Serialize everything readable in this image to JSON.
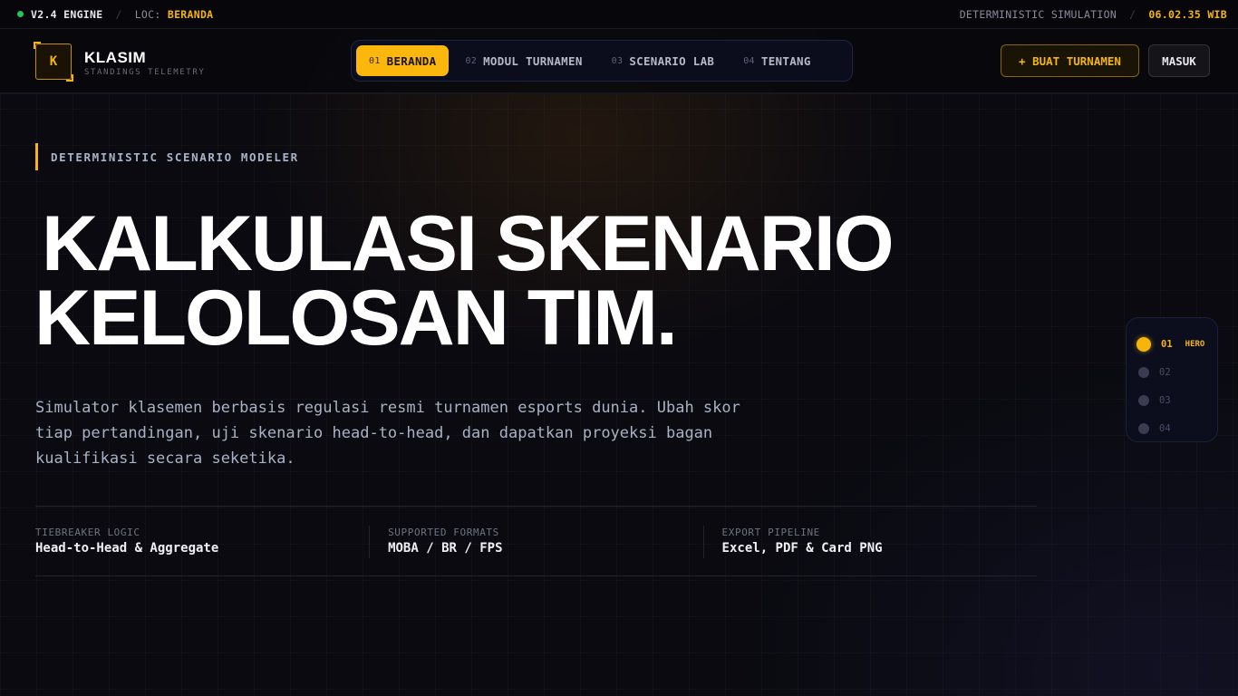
{
  "status_bar": {
    "engine": "V2.4 ENGINE",
    "loc_label": "LOC:",
    "loc_value": "BERANDA",
    "mode": "DETERMINISTIC SIMULATION",
    "time": "06.02.35 WIB"
  },
  "brand": {
    "logo_letter": "K",
    "name": "KLASIM",
    "tagline": "STANDINGS TELEMETRY"
  },
  "nav": {
    "items": [
      {
        "num": "01",
        "label": "BERANDA",
        "active": true
      },
      {
        "num": "02",
        "label": "MODUL TURNAMEN",
        "active": false
      },
      {
        "num": "03",
        "label": "SCENARIO LAB",
        "active": false
      },
      {
        "num": "04",
        "label": "TENTANG",
        "active": false
      }
    ]
  },
  "actions": {
    "create_label": "+ BUAT TURNAMEN",
    "login_label": "MASUK"
  },
  "hero": {
    "kicker": "DETERMINISTIC SCENARIO MODELER",
    "title_line1": "KALKULASI SKENARIO",
    "title_line2": "KELOLOSAN TIM.",
    "description": "Simulator klasemen berbasis regulasi resmi turnamen esports dunia. Ubah skor tiap pertandingan, uji skenario head-to-head, dan dapatkan proyeksi bagan kualifikasi secara seketika."
  },
  "stats": [
    {
      "label": "TIEBREAKER LOGIC",
      "value": "Head-to-Head & Aggregate"
    },
    {
      "label": "SUPPORTED FORMATS",
      "value": "MOBA / BR / FPS"
    },
    {
      "label": "EXPORT PIPELINE",
      "value": "Excel, PDF & Card PNG"
    }
  ],
  "section_progress": [
    {
      "num": "01",
      "tag": "HERO",
      "active": true
    },
    {
      "num": "02",
      "tag": "",
      "active": false
    },
    {
      "num": "03",
      "tag": "",
      "active": false
    },
    {
      "num": "04",
      "tag": "",
      "active": false
    }
  ],
  "colors": {
    "accent": "#f5b50a",
    "status_online": "#22c55e",
    "background": "#0a0a10"
  }
}
